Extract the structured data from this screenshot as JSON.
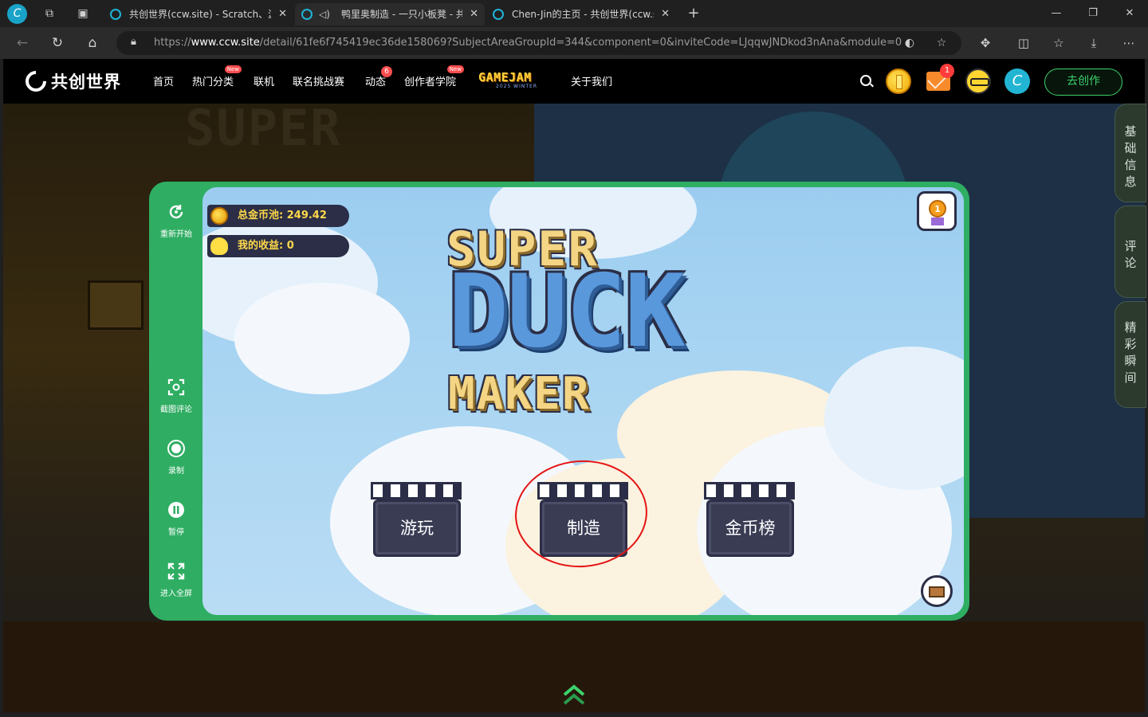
{
  "browser": {
    "profile_initial": "C",
    "tabs": [
      {
        "title": "共创世界(ccw.site) - Scratch、游戏",
        "active": false
      },
      {
        "title": "鸭里奥制造 - 一只小板凳 - 共",
        "active": true
      },
      {
        "title": "Chen-Jin的主页 - 共创世界(ccw.site)",
        "active": false
      }
    ],
    "url_prefix": "https://",
    "url_host": "www.ccw.site",
    "url_path": "/detail/61fe6f745419ec36de158069?SubjectAreaGroupId=344&component=0&inviteCode=LJqqwJNDkod3nAna&module=0"
  },
  "site": {
    "logo_text": "共创世界",
    "nav": [
      {
        "label": "首页",
        "badge": ""
      },
      {
        "label": "热门分类",
        "badge": "New"
      },
      {
        "label": "联机",
        "badge": ""
      },
      {
        "label": "联名挑战赛",
        "badge": ""
      },
      {
        "label": "动态",
        "badge": "6"
      },
      {
        "label": "创作者学院",
        "badge": "New"
      },
      {
        "label": "关于我们",
        "badge": ""
      }
    ],
    "gamejam": {
      "title": "GAMEJAM",
      "subtitle": "2025 WINTER"
    },
    "mail_count": "1",
    "avatar_initial": "C",
    "create_button": "去创作"
  },
  "side_tabs": [
    "基础信息",
    "评论",
    "精彩瞬间"
  ],
  "player_controls": [
    {
      "label": "重新开始",
      "icon": "restart-icon"
    },
    {
      "label": "截图评论",
      "icon": "screenshot-icon"
    },
    {
      "label": "录制",
      "icon": "record-icon"
    },
    {
      "label": "暂停",
      "icon": "pause-icon"
    },
    {
      "label": "进入全屏",
      "icon": "fullscreen-icon"
    }
  ],
  "game": {
    "pool_label": "总金币池:",
    "pool_value": "249.42",
    "earnings_label": "我的收益:",
    "earnings_value": "0",
    "title_line1": "SUPER",
    "title_line2": "DUCK",
    "title_line3": "MAKER",
    "medal_rank": "1",
    "buttons": [
      "游玩",
      "制造",
      "金币榜"
    ]
  },
  "colors": {
    "frame_green": "#2fae63",
    "accent_green": "#3dd36c",
    "annotation_red": "#e41414"
  }
}
